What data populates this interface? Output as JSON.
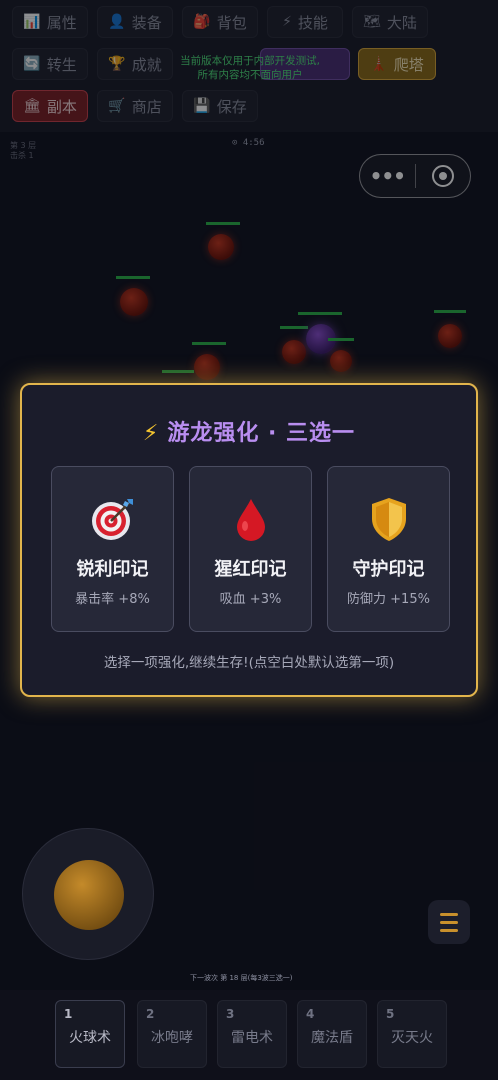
{
  "tabs": [
    {
      "label": "属性",
      "icon": "📊"
    },
    {
      "label": "装备",
      "icon": "👤"
    },
    {
      "label": "背包",
      "icon": "🎒"
    },
    {
      "label": "技能",
      "icon": "⚡"
    },
    {
      "label": "大陆",
      "icon": "🗺"
    },
    {
      "label": "转生",
      "icon": "🔄"
    },
    {
      "label": "成就",
      "icon": "🏆"
    },
    {
      "label": "爬塔",
      "icon": "🗼"
    },
    {
      "label": "副本",
      "icon": "🏛"
    },
    {
      "label": "商店",
      "icon": "🛒"
    },
    {
      "label": "保存",
      "icon": "💾"
    }
  ],
  "notice": {
    "line1": "当前版本仅用于内部开发测试,",
    "line2": "所有内容均不面向用户"
  },
  "hud": {
    "level": "第 3 层",
    "sub": "击杀 1",
    "timer": "⊙ 4:56"
  },
  "modal": {
    "title": "游龙强化 · 三选一",
    "cards": [
      {
        "name": "锐利印记",
        "desc": "暴击率 +8%",
        "icon": "target-icon"
      },
      {
        "name": "猩红印记",
        "desc": "吸血 +3%",
        "icon": "blood-drop-icon"
      },
      {
        "name": "守护印记",
        "desc": "防御力 +15%",
        "icon": "shield-icon"
      }
    ],
    "hint": "选择一项强化,继续生存!(点空白处默认选第一项)"
  },
  "wave_text": "下一波次  第 18 层(每3波三选一)",
  "skills": [
    {
      "num": "1",
      "name": "火球术"
    },
    {
      "num": "2",
      "name": "冰咆哮"
    },
    {
      "num": "3",
      "name": "雷电术"
    },
    {
      "num": "4",
      "name": "魔法盾"
    },
    {
      "num": "5",
      "name": "灭天火"
    }
  ],
  "colors": {
    "accent_gold": "#e2b54c",
    "title_purple": "#b98ef0",
    "notice_green": "#4fe07a",
    "enemy_red": "#c2361f"
  }
}
